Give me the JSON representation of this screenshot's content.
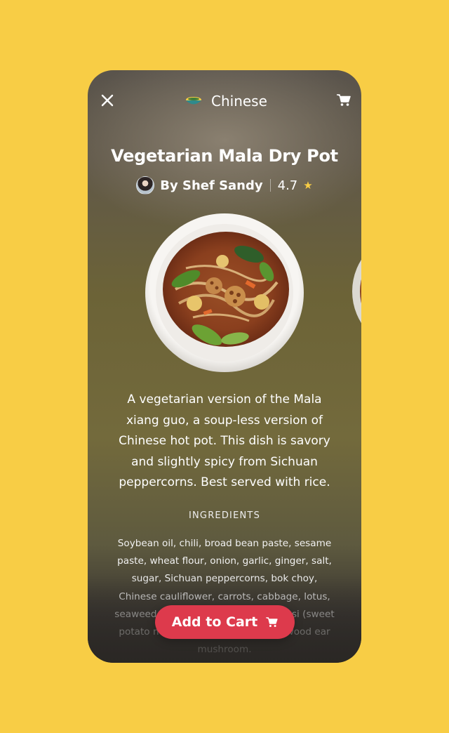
{
  "header": {
    "category": "Chinese",
    "close_icon": "close-icon",
    "cart_icon": "cart-icon",
    "category_icon": "food-bowl-icon"
  },
  "dish": {
    "title": "Vegetarian Mala Dry Pot",
    "chef": "By Shef Sandy",
    "rating": "4.7",
    "description": "A vegetarian version of the Mala xiang guo, a soup-less version of Chinese hot pot. This dish is savory and slightly spicy from Sichuan peppercorns. Best served with rice.",
    "ingredients_heading": "INGREDIENTS",
    "ingredients": "Soybean oil, chili, broad bean paste, sesame paste, wheat flour, onion, garlic, ginger, salt, sugar, Sichuan peppercorns, bok choy, Chinese cauliflower, carrots, cabbage, lotus, seaweed, shimeji, soybean curd, fen si (sweet potato noodles), enoki mushroom, wood ear mushroom."
  },
  "actions": {
    "add_to_cart": "Add to Cart"
  },
  "colors": {
    "page_background": "#F8CD45",
    "accent_button": "#DD3A4C",
    "star": "#F8CD45"
  }
}
